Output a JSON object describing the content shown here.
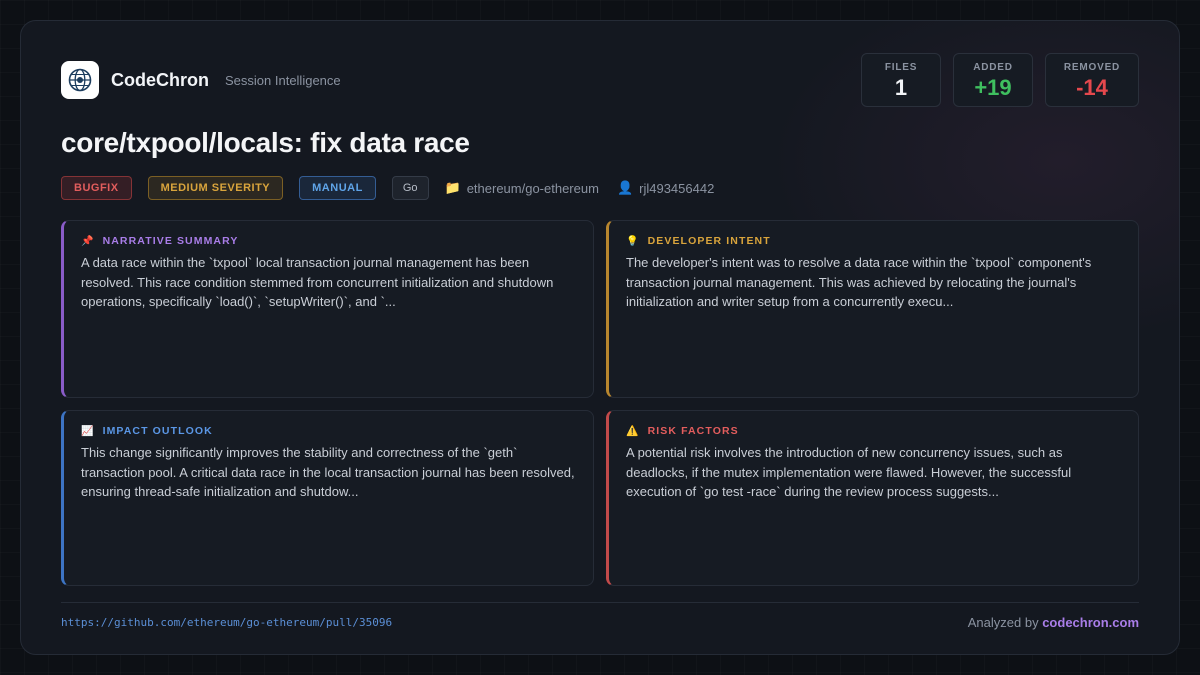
{
  "brand": {
    "name": "CodeChron",
    "subtitle": "Session Intelligence",
    "logo_icon": "globe-network-icon"
  },
  "stats": {
    "files": {
      "label": "FILES",
      "value": "1"
    },
    "added": {
      "label": "ADDED",
      "value": "+19",
      "color": "#3fbf5f"
    },
    "removed": {
      "label": "REMOVED",
      "value": "-14",
      "color": "#e5484d"
    }
  },
  "title": "core/txpool/locals: fix data race",
  "tags": {
    "type": "BUGFIX",
    "severity": "MEDIUM SEVERITY",
    "mode": "MANUAL",
    "language": "Go"
  },
  "meta": {
    "repo": "ethereum/go-ethereum",
    "repo_icon": "folder-icon",
    "author": "rjl493456442",
    "author_icon": "user-icon"
  },
  "panels": {
    "narrative": {
      "icon": "pushpin-icon",
      "title": "NARRATIVE SUMMARY",
      "body": "A data race within the `txpool` local transaction journal management has been resolved. This race condition stemmed from concurrent initialization and shutdown operations, specifically `load()`, `setupWriter()`, and `..."
    },
    "intent": {
      "icon": "lightbulb-icon",
      "title": "DEVELOPER INTENT",
      "body": "The developer's intent was to resolve a data race within the `txpool` component's transaction journal management. This was achieved by relocating the journal's initialization and writer setup from a concurrently execu..."
    },
    "impact": {
      "icon": "chart-up-icon",
      "title": "IMPACT OUTLOOK",
      "body": "This change significantly improves the stability and correctness of the `geth` transaction pool. A critical data race in the local transaction journal has been resolved, ensuring thread-safe initialization and shutdow..."
    },
    "risk": {
      "icon": "warning-icon",
      "title": "RISK FACTORS",
      "body": "A potential risk involves the introduction of new concurrency issues, such as deadlocks, if the mutex implementation were flawed. However, the successful execution of `go test -race` during the review process suggests..."
    }
  },
  "footer": {
    "url": "https://github.com/ethereum/go-ethereum/pull/35096",
    "analyzed_prefix": "Analyzed by",
    "site": "codechron.com"
  }
}
